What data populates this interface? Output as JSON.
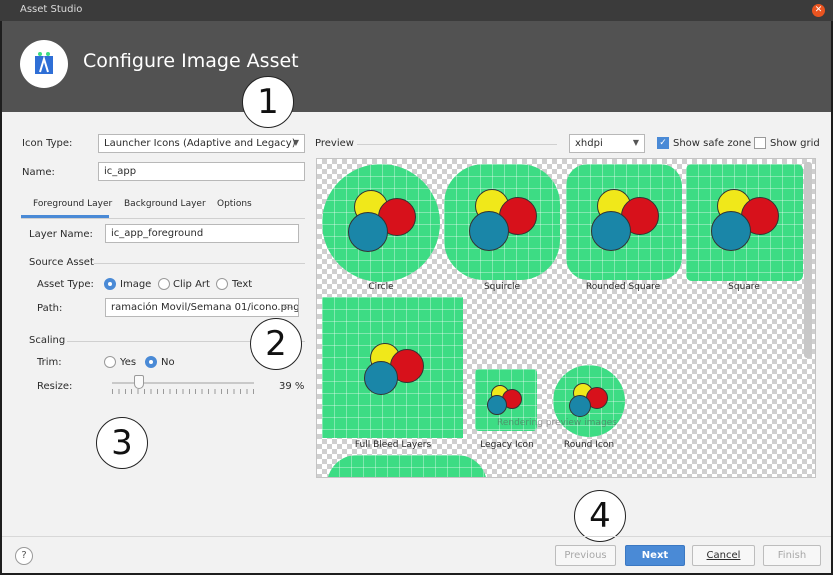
{
  "window": {
    "title": "Asset Studio",
    "close_icon": "close-icon"
  },
  "header": {
    "title": "Configure Image Asset",
    "logo_icon": "android-studio-icon"
  },
  "form": {
    "icon_type_label": "Icon Type:",
    "icon_type_value": "Launcher Icons (Adaptive and Legacy)",
    "name_label": "Name:",
    "name_value": "ic_app",
    "tabs": [
      "Foreground Layer",
      "Background Layer",
      "Options"
    ],
    "layer_name_label": "Layer Name:",
    "layer_name_value": "ic_app_foreground",
    "source_asset_heading": "Source Asset",
    "asset_type_label": "Asset Type:",
    "asset_types": [
      "Image",
      "Clip Art",
      "Text"
    ],
    "asset_type_selected": "Image",
    "path_label": "Path:",
    "path_value": "ramación Movil/Semana 01/icono.png",
    "folder_icon": "folder-icon",
    "scaling_heading": "Scaling",
    "trim_label": "Trim:",
    "trim_options": [
      "Yes",
      "No"
    ],
    "trim_selected": "No",
    "resize_label": "Resize:",
    "resize_value": 39,
    "resize_text": "39 %"
  },
  "preview": {
    "label": "Preview",
    "density": "xhdpi",
    "show_safe_zone_label": "Show safe zone",
    "show_safe_zone": true,
    "show_grid_label": "Show grid",
    "show_grid": false,
    "icons": [
      "Circle",
      "Squircle",
      "Rounded Square",
      "Square",
      "Full Bleed Layers",
      "Legacy Icon",
      "Round Icon"
    ],
    "rendering_text": "Rendering preview images",
    "colors": {
      "background": "#3ddc84",
      "yellow": "#f0e81a",
      "red": "#d7111b",
      "blue": "#1a86a8"
    }
  },
  "annotations": [
    "1",
    "2",
    "3",
    "4"
  ],
  "footer": {
    "help_label": "?",
    "previous_label": "Previous",
    "next_label": "Next",
    "cancel_label": "Cancel",
    "finish_label": "Finish"
  }
}
